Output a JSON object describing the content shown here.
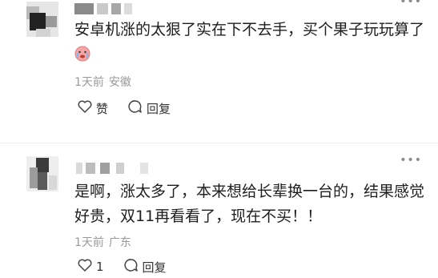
{
  "comments": [
    {
      "text_before_emoji": "安卓机涨的太狠了实在下不去手，买个果子玩玩算了",
      "emoji": "crying-face-emoji",
      "meta_time": "1天前",
      "meta_location": "安徽",
      "like_label": "赞",
      "reply_label": "回复",
      "more_label": "•••"
    },
    {
      "text": "是啊，涨太多了，本来想给长辈换一台的，结果感觉好贵，双11再看看了，现在不买！！",
      "meta_time": "1天前",
      "meta_location": "广东",
      "like_count": "1",
      "reply_label": "回复",
      "more_label": "•••"
    }
  ],
  "colors": {
    "text": "#1e1e1e",
    "meta": "#9a9a9a",
    "icon": "#444444"
  }
}
